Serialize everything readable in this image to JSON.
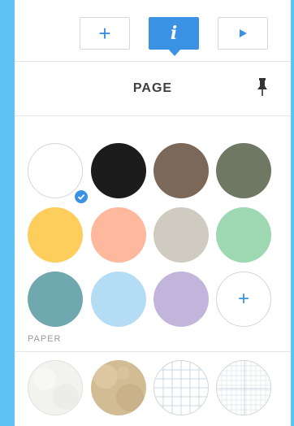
{
  "toolbar": {
    "add_icon": "plus-icon",
    "info_icon": "info-icon",
    "play_icon": "play-icon",
    "active": "info",
    "accent": "#3b92e4"
  },
  "header": {
    "title": "PAGE",
    "pin_icon": "pin-icon"
  },
  "colors": {
    "swatches": [
      {
        "name": "white",
        "hex": "#ffffff",
        "selected": true
      },
      {
        "name": "black",
        "hex": "#1c1c1c"
      },
      {
        "name": "brown",
        "hex": "#7c6859"
      },
      {
        "name": "olive",
        "hex": "#6f7862"
      },
      {
        "name": "yellow",
        "hex": "#fece5d"
      },
      {
        "name": "peach",
        "hex": "#fdb89e"
      },
      {
        "name": "stone",
        "hex": "#cfcbc1"
      },
      {
        "name": "mint",
        "hex": "#9dd8b3"
      },
      {
        "name": "teal",
        "hex": "#6fa8af"
      },
      {
        "name": "light-blue",
        "hex": "#b5dcf5"
      },
      {
        "name": "lavender",
        "hex": "#c2b5dc"
      }
    ],
    "add_icon": "plus-icon"
  },
  "paper": {
    "label": "PAPER",
    "options": [
      "plain",
      "kraft",
      "grid",
      "fine-grid"
    ]
  }
}
